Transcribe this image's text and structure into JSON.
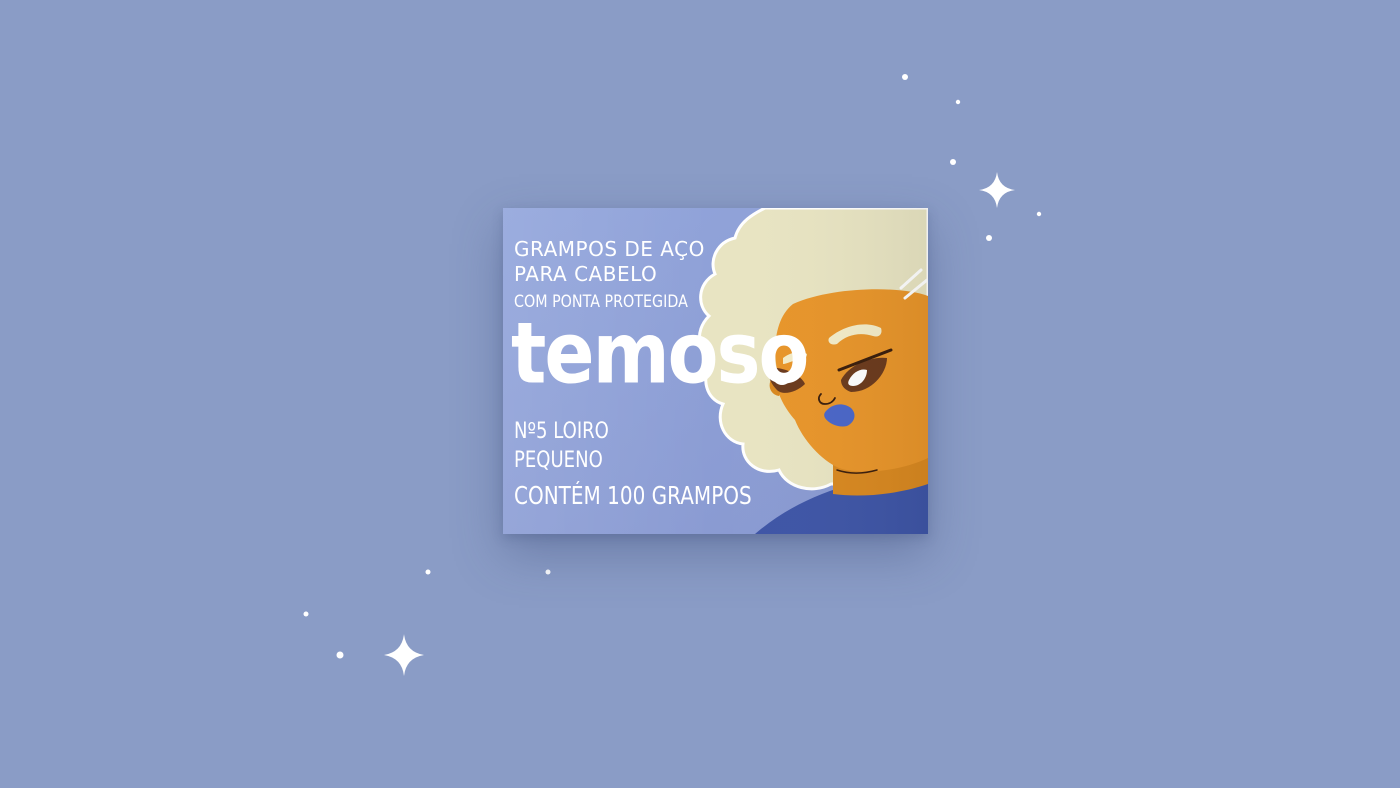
{
  "colors": {
    "background": "#8a9cc6",
    "package": "#8e9fd6",
    "hair": "#e8e4c2",
    "skin": "#e8952a",
    "shirt": "#3e55a6",
    "lips": "#4a66c8",
    "eye_iris": "#6b3a1c",
    "text": "#ffffff"
  },
  "package": {
    "line_1": "GRAMPOS DE AÇO",
    "line_2": "PARA CABELO",
    "line_3": "COM PONTA PROTEGIDA",
    "brand": "temoso",
    "line_5": "Nº5 LOIRO",
    "line_6": "PEQUENO",
    "line_7": "CONTÉM 100 GRAMPOS"
  },
  "decorations": {
    "sparkle_icon": "four-point-star",
    "dot_icon": "dot"
  }
}
